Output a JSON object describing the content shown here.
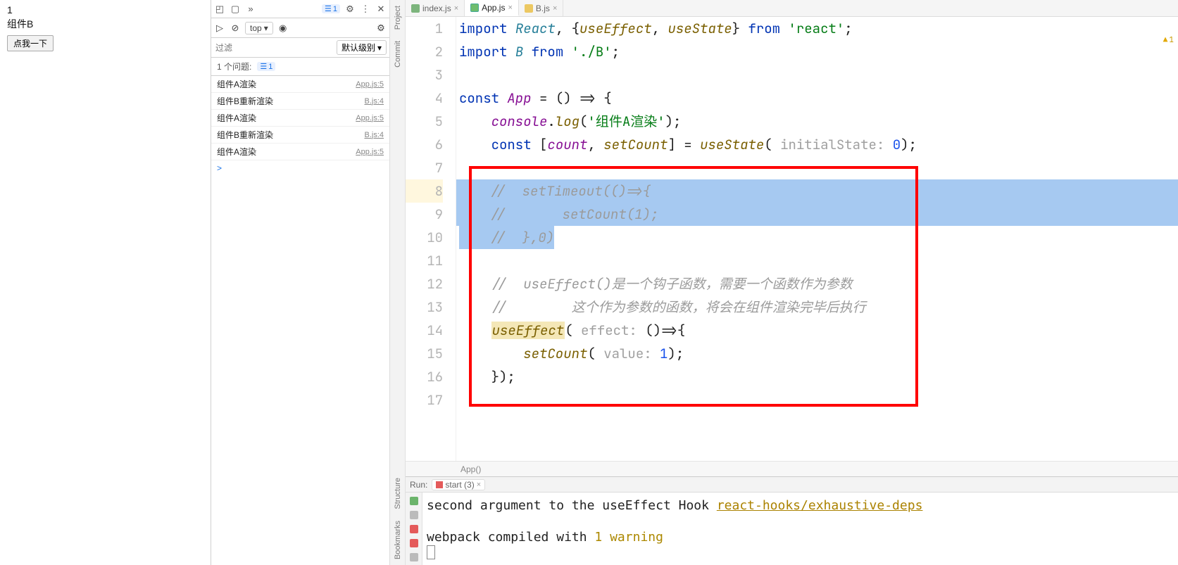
{
  "browser": {
    "line1": "1",
    "line2": "组件B",
    "button": "点我一下"
  },
  "devtools": {
    "badge": "1",
    "scope": "top",
    "filter_placeholder": "过滤",
    "level": "默认级别",
    "issues_label": "1 个问题:",
    "issues_count": "1",
    "items": [
      {
        "msg": "组件A渲染",
        "loc": "App.js:5"
      },
      {
        "msg": "组件B重新渲染",
        "loc": "B.js:4"
      },
      {
        "msg": "组件A渲染",
        "loc": "App.js:5"
      },
      {
        "msg": "组件B重新渲染",
        "loc": "B.js:4"
      },
      {
        "msg": "组件A渲染",
        "loc": "App.js:5"
      }
    ],
    "prompt": ">"
  },
  "vtabs_left": [
    "Project",
    "Commit"
  ],
  "vtabs_bottom": [
    "Structure",
    "Bookmarks"
  ],
  "file_tabs": {
    "t0": "index.js",
    "t1": "App.js",
    "t2": "B.js"
  },
  "editor": {
    "lines": [
      "1",
      "2",
      "3",
      "4",
      "5",
      "6",
      "7",
      "8",
      "9",
      "10",
      "11",
      "12",
      "13",
      "14",
      "15",
      "16",
      "17"
    ],
    "l1": {
      "a": "import ",
      "b": "React",
      "c": ", {",
      "d": "useEffect",
      "e": ", ",
      "f": "useState",
      "g": "} ",
      "h": "from ",
      "i": "'react'",
      "j": ";"
    },
    "l2": {
      "a": "import ",
      "b": "B ",
      "c": "from ",
      "d": "'./B'",
      "e": ";"
    },
    "l4": {
      "a": "const ",
      "b": "App ",
      "c": "= () => {"
    },
    "l5": {
      "a": "console",
      "b": ".",
      "c": "log",
      "d": "(",
      "e": "'组件A渲染'",
      "f": ");"
    },
    "l6": {
      "a": "const ",
      "b": "[",
      "c": "count",
      "d": ", ",
      "e": "setCount",
      "f": "] = ",
      "g": "useState",
      "h": "(",
      "i": " initialState: ",
      "j": "0",
      "k": ");"
    },
    "l8": "//  setTimeout(()=>{",
    "l9": "//       setCount(1);",
    "l10": "//  },0)",
    "l12": "//  useEffect()是一个钩子函数，需要一个函数作为参数",
    "l13": "//        这个作为参数的函数，将会在组件渲染完毕后执行",
    "l14": {
      "a": "useEffect",
      "b": "(",
      "c": " effect: ",
      "d": "()=>{",
      "e": ""
    },
    "l15": {
      "a": "setCount",
      "b": "(",
      "c": " value: ",
      "d": "1",
      "e": ");"
    },
    "l16": "});",
    "breadcrumb": "App()"
  },
  "run": {
    "label": "Run:",
    "tab": "start (3)",
    "l1a": "second argument to the useEffect Hook   ",
    "l1b": "react-hooks/exhaustive-deps",
    "l2a": "webpack compiled with ",
    "l2b": "1 warning"
  },
  "top_warn": "1"
}
